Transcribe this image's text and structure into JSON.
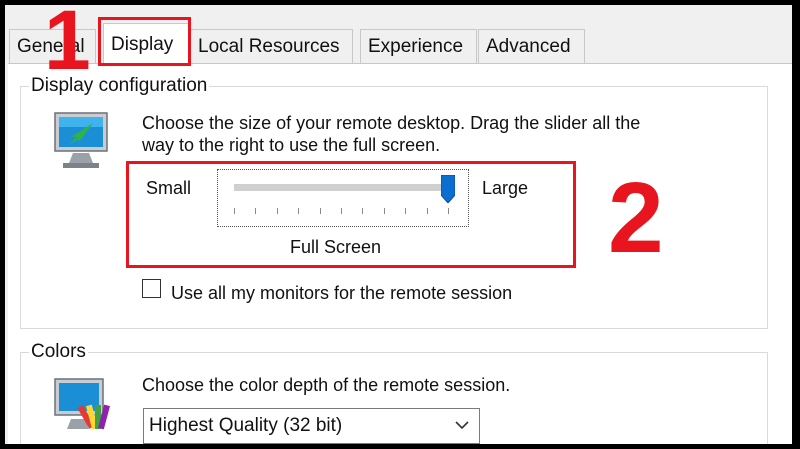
{
  "tabs": [
    {
      "label": "General",
      "active": false
    },
    {
      "label": "Display",
      "active": true
    },
    {
      "label": "Local Resources",
      "active": false
    },
    {
      "label": "Experience",
      "active": false
    },
    {
      "label": "Advanced",
      "active": false
    }
  ],
  "display_config": {
    "legend": "Display configuration",
    "description_line1": "Choose the size of your remote desktop. Drag the slider all the",
    "description_line2": "way to the right to use the full screen.",
    "icon": "monitor-with-arrow-icon",
    "slider": {
      "min_label": "Small",
      "max_label": "Large",
      "value_label": "Full Screen",
      "position_fraction": 1.0
    },
    "monitors_checkbox": {
      "label": "Use all my monitors for the remote session",
      "checked": false
    }
  },
  "colors": {
    "legend": "Colors",
    "description": "Choose the color depth of the remote session.",
    "icon": "monitor-color-palette-icon",
    "select": {
      "value": "Highest Quality (32 bit)"
    }
  },
  "annotations": {
    "step1": "1",
    "step2": "2",
    "color": "#e8141e"
  }
}
